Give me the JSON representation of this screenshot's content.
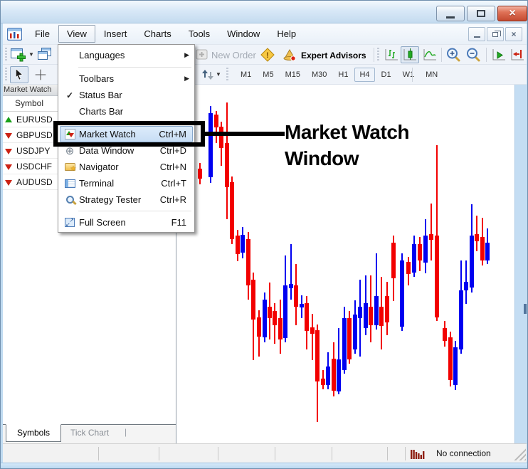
{
  "window_controls": [
    "minimize",
    "maximize",
    "close"
  ],
  "child_window_controls": [
    "minimize",
    "restore",
    "close"
  ],
  "menu_bar": {
    "items": [
      "File",
      "View",
      "Insert",
      "Charts",
      "Tools",
      "Window",
      "Help"
    ],
    "active_item": "View"
  },
  "toolbar_top": {
    "new_order_label": "New Order",
    "expert_advisors_label": "Expert Advisors",
    "selected_chart_type": "candlestick"
  },
  "toolbar_chart": {
    "timeframes": [
      "M1",
      "M5",
      "M15",
      "M30",
      "H1",
      "H4",
      "D1",
      "W1",
      "MN"
    ],
    "selected_timeframe": "H4"
  },
  "view_menu": {
    "items": [
      {
        "label": "Languages",
        "submenu": true
      },
      {
        "separator": true
      },
      {
        "label": "Toolbars",
        "submenu": true
      },
      {
        "label": "Status Bar",
        "checked": true
      },
      {
        "label": "Charts Bar"
      },
      {
        "separator": true
      },
      {
        "label": "Market Watch",
        "shortcut": "Ctrl+M",
        "icon": "market-watch",
        "highlighted": true
      },
      {
        "label": "Data Window",
        "shortcut": "Ctrl+D",
        "icon": "data-window"
      },
      {
        "label": "Navigator",
        "shortcut": "Ctrl+N",
        "icon": "navigator"
      },
      {
        "label": "Terminal",
        "shortcut": "Ctrl+T",
        "icon": "terminal"
      },
      {
        "label": "Strategy Tester",
        "shortcut": "Ctrl+R",
        "icon": "strategy-tester"
      },
      {
        "separator": true
      },
      {
        "label": "Full Screen",
        "shortcut": "F11",
        "icon": "full-screen"
      }
    ]
  },
  "annotation": {
    "line1": "Market Watch",
    "line2": "Window"
  },
  "market_watch": {
    "title": "Market Watch",
    "column_header": "Symbol",
    "symbols": [
      {
        "name": "EURUSD",
        "direction": "up"
      },
      {
        "name": "GBPUSD",
        "direction": "down"
      },
      {
        "name": "USDJPY",
        "direction": "down"
      },
      {
        "name": "USDCHF",
        "direction": "down"
      },
      {
        "name": "AUDUSD",
        "direction": "down"
      }
    ],
    "tabs": [
      "Symbols",
      "Tick Chart"
    ],
    "active_tab": "Symbols"
  },
  "status_bar": {
    "connection_status": "No connection"
  },
  "colors": {
    "bull_candle": "#0000f0",
    "bear_candle": "#f20000",
    "annotation": "#000000",
    "up_arrow": "#18a018",
    "down_arrow": "#cc2214",
    "selection_border": "#86a7cb"
  },
  "chart_data": {
    "type": "candlestick",
    "timeframe": "H4",
    "price_axis_labels_visible": false,
    "up_color": "#0000f0",
    "down_color": "#f20000",
    "coordinates": "pixels, relative to chart area origin",
    "candles": [
      [
        30,
        "d",
        110,
        140,
        118,
        132
      ],
      [
        45,
        "u",
        30,
        138,
        40,
        130
      ],
      [
        53,
        "d",
        37,
        82,
        42,
        60
      ],
      [
        60,
        "d",
        52,
        114,
        59,
        89
      ],
      [
        68,
        "d",
        25,
        189,
        82,
        144
      ],
      [
        75,
        "d",
        129,
        224,
        137,
        217
      ],
      [
        83,
        "d",
        204,
        248,
        212,
        238
      ],
      [
        90,
        "u",
        200,
        244,
        211,
        236
      ],
      [
        98,
        "d",
        207,
        302,
        217,
        282
      ],
      [
        105,
        "d",
        264,
        387,
        274,
        330
      ],
      [
        113,
        "d",
        317,
        382,
        327,
        354
      ],
      [
        121,
        "u",
        292,
        362,
        302,
        355
      ],
      [
        128,
        "d",
        278,
        358,
        312,
        328
      ],
      [
        135,
        "d",
        307,
        364,
        318,
        338
      ],
      [
        143,
        "d",
        302,
        378,
        328,
        358
      ],
      [
        150,
        "u",
        240,
        362,
        282,
        356
      ],
      [
        158,
        "u",
        224,
        302,
        280,
        286
      ],
      [
        165,
        "d",
        252,
        338,
        282,
        312
      ],
      [
        173,
        "u",
        296,
        328,
        308,
        313
      ],
      [
        180,
        "d",
        297,
        372,
        307,
        346
      ],
      [
        188,
        "d",
        322,
        387,
        341,
        350
      ],
      [
        195,
        "d",
        337,
        474,
        345,
        417
      ],
      [
        203,
        "d",
        401,
        428,
        413,
        422
      ],
      [
        210,
        "u",
        376,
        428,
        396,
        422
      ],
      [
        218,
        "d",
        362,
        438,
        385,
        430
      ],
      [
        225,
        "u",
        342,
        435,
        386,
        431
      ],
      [
        233,
        "u",
        312,
        406,
        328,
        401
      ],
      [
        240,
        "d",
        318,
        392,
        328,
        386
      ],
      [
        248,
        "u",
        303,
        378,
        323,
        372
      ],
      [
        255,
        "u",
        274,
        382,
        312,
        328
      ],
      [
        263,
        "u",
        268,
        352,
        307,
        342
      ],
      [
        270,
        "d",
        268,
        362,
        312,
        338
      ],
      [
        278,
        "u",
        237,
        344,
        297,
        338
      ],
      [
        285,
        "d",
        270,
        372,
        312,
        339
      ],
      [
        293,
        "d",
        277,
        352,
        297,
        334
      ],
      [
        302,
        "d",
        212,
        304,
        222,
        272
      ],
      [
        314,
        "u",
        237,
        346,
        247,
        340
      ],
      [
        323,
        "d",
        242,
        282,
        249,
        266
      ],
      [
        331,
        "u",
        212,
        270,
        224,
        264
      ],
      [
        339,
        "d",
        214,
        262,
        224,
        247
      ],
      [
        347,
        "u",
        189,
        265,
        212,
        250
      ],
      [
        355,
        "d",
        167,
        247,
        210,
        218
      ],
      [
        363,
        "d",
        85,
        332,
        212,
        327
      ],
      [
        374,
        "d",
        332,
        368,
        342,
        360
      ],
      [
        382,
        "d",
        347,
        424,
        355,
        415
      ],
      [
        389,
        "u",
        360,
        429,
        369,
        422
      ],
      [
        397,
        "u",
        247,
        378,
        289,
        372
      ],
      [
        404,
        "u",
        247,
        308,
        277,
        289
      ],
      [
        412,
        "u",
        168,
        292,
        212,
        285
      ],
      [
        419,
        "d",
        184,
        234,
        210,
        220
      ],
      [
        427,
        "d",
        187,
        254,
        214,
        247
      ],
      [
        434,
        "u",
        202,
        252,
        222,
        247
      ]
    ]
  }
}
